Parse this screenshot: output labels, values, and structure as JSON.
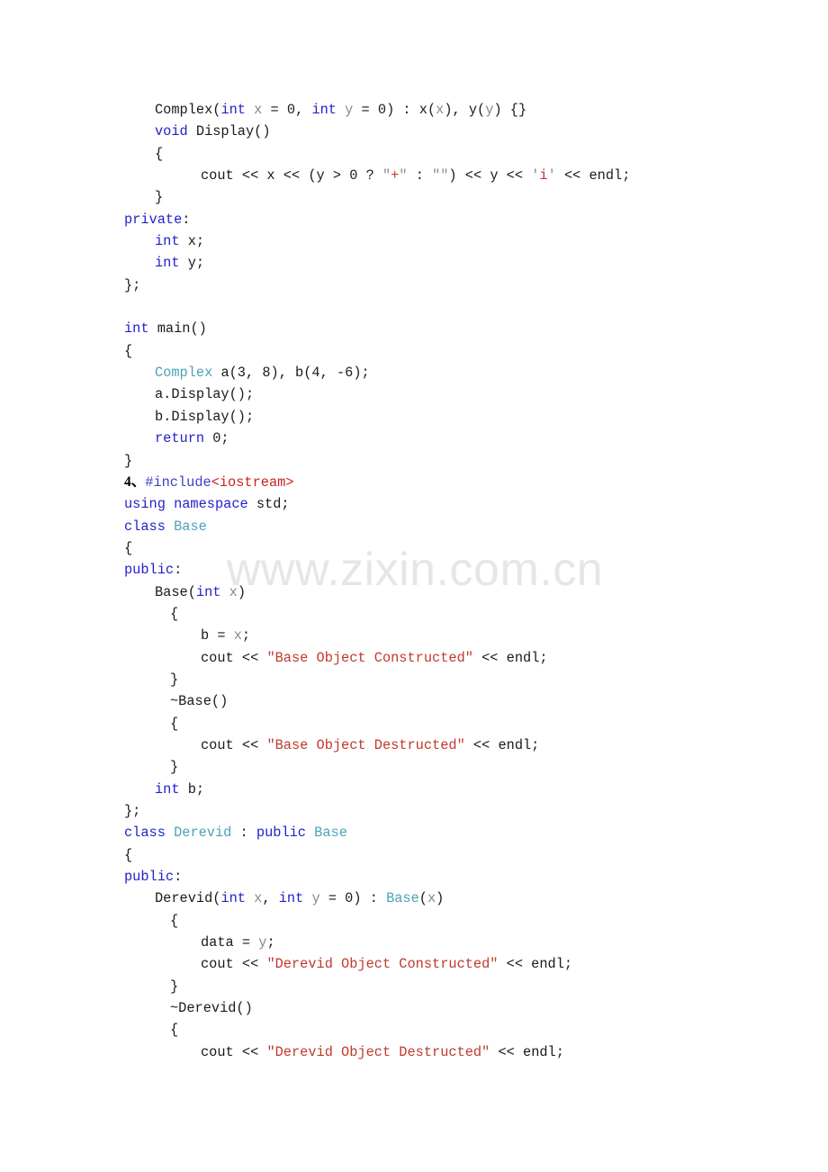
{
  "document": {
    "type": "code-listing",
    "language": "C++",
    "watermark": "www.zixin.com.cn"
  },
  "colors": {
    "keyword": "#2222cc",
    "user_type": "#4ba3b8",
    "string": "#c0392b",
    "preprocessor": "#4040c8",
    "include_header": "#cc2222",
    "parameter": "#888888",
    "plain": "#1a1a1a",
    "watermark": "#e6e6e6",
    "background": "#ffffff"
  },
  "code_lines": [
    {
      "indent": 1,
      "tokens": [
        {
          "t": "Complex(",
          "c": "plain"
        },
        {
          "t": "int",
          "c": "kw"
        },
        {
          "t": " ",
          "c": "plain"
        },
        {
          "t": "x",
          "c": "param"
        },
        {
          "t": " = 0, ",
          "c": "plain"
        },
        {
          "t": "int",
          "c": "kw"
        },
        {
          "t": " ",
          "c": "plain"
        },
        {
          "t": "y",
          "c": "param"
        },
        {
          "t": " = 0) : x(",
          "c": "plain"
        },
        {
          "t": "x",
          "c": "param"
        },
        {
          "t": "), y(",
          "c": "plain"
        },
        {
          "t": "y",
          "c": "param"
        },
        {
          "t": ") {}",
          "c": "plain"
        }
      ]
    },
    {
      "indent": 1,
      "tokens": [
        {
          "t": "void",
          "c": "kw"
        },
        {
          "t": " Display()",
          "c": "plain"
        }
      ]
    },
    {
      "indent": 1,
      "tokens": [
        {
          "t": "{",
          "c": "plain"
        }
      ]
    },
    {
      "indent": 3,
      "tokens": [
        {
          "t": "cout << x << (y > 0 ? ",
          "c": "plain"
        },
        {
          "t": "\"",
          "c": "strq"
        },
        {
          "t": "+",
          "c": "str"
        },
        {
          "t": "\"",
          "c": "strq"
        },
        {
          "t": " : ",
          "c": "plain"
        },
        {
          "t": "\"\"",
          "c": "strq"
        },
        {
          "t": ") << y << ",
          "c": "plain"
        },
        {
          "t": "'",
          "c": "strq"
        },
        {
          "t": "i",
          "c": "str"
        },
        {
          "t": "'",
          "c": "strq"
        },
        {
          "t": " << endl;",
          "c": "plain"
        }
      ]
    },
    {
      "indent": 1,
      "tokens": [
        {
          "t": "}",
          "c": "plain"
        }
      ]
    },
    {
      "indent": 0,
      "tokens": [
        {
          "t": "private",
          "c": "kw"
        },
        {
          "t": ":",
          "c": "plain"
        }
      ]
    },
    {
      "indent": 1,
      "tokens": [
        {
          "t": "int",
          "c": "kw"
        },
        {
          "t": " x;",
          "c": "plain"
        }
      ]
    },
    {
      "indent": 1,
      "tokens": [
        {
          "t": "int",
          "c": "kw"
        },
        {
          "t": " y;",
          "c": "plain"
        }
      ]
    },
    {
      "indent": 0,
      "tokens": [
        {
          "t": "};",
          "c": "plain"
        }
      ]
    },
    {
      "indent": 0,
      "tokens": [
        {
          "t": "",
          "c": "plain"
        }
      ]
    },
    {
      "indent": 0,
      "tokens": [
        {
          "t": "int",
          "c": "kw"
        },
        {
          "t": " main()",
          "c": "plain"
        }
      ]
    },
    {
      "indent": 0,
      "tokens": [
        {
          "t": "{",
          "c": "plain"
        }
      ]
    },
    {
      "indent": 1,
      "tokens": [
        {
          "t": "Complex",
          "c": "type"
        },
        {
          "t": " a(3, 8), b(4, -6);",
          "c": "plain"
        }
      ]
    },
    {
      "indent": 1,
      "tokens": [
        {
          "t": "a.Display();",
          "c": "plain"
        }
      ]
    },
    {
      "indent": 1,
      "tokens": [
        {
          "t": "b.Display();",
          "c": "plain"
        }
      ]
    },
    {
      "indent": 1,
      "tokens": [
        {
          "t": "return",
          "c": "kw"
        },
        {
          "t": " 0;",
          "c": "plain"
        }
      ]
    },
    {
      "indent": 0,
      "tokens": [
        {
          "t": "}",
          "c": "plain"
        }
      ]
    },
    {
      "indent": 0,
      "tokens": [
        {
          "t": "4、",
          "c": "qnum"
        },
        {
          "t": "#include",
          "c": "pre"
        },
        {
          "t": "<iostream>",
          "c": "inc"
        }
      ]
    },
    {
      "indent": 0,
      "tokens": [
        {
          "t": "using namespace",
          "c": "kw"
        },
        {
          "t": " std;",
          "c": "plain"
        }
      ]
    },
    {
      "indent": 0,
      "tokens": [
        {
          "t": "class",
          "c": "kw"
        },
        {
          "t": " ",
          "c": "plain"
        },
        {
          "t": "Base",
          "c": "type"
        }
      ]
    },
    {
      "indent": 0,
      "tokens": [
        {
          "t": "{",
          "c": "plain"
        }
      ]
    },
    {
      "indent": 0,
      "tokens": [
        {
          "t": "public",
          "c": "kw"
        },
        {
          "t": ":",
          "c": "plain"
        }
      ]
    },
    {
      "indent": 1,
      "tokens": [
        {
          "t": "Base(",
          "c": "plain"
        },
        {
          "t": "int",
          "c": "kw"
        },
        {
          "t": " ",
          "c": "plain"
        },
        {
          "t": "x",
          "c": "param"
        },
        {
          "t": ")",
          "c": "plain"
        }
      ]
    },
    {
      "indent": 2,
      "tokens": [
        {
          "t": "{",
          "c": "plain"
        }
      ]
    },
    {
      "indent": 3,
      "tokens": [
        {
          "t": "b = ",
          "c": "plain"
        },
        {
          "t": "x",
          "c": "param"
        },
        {
          "t": ";",
          "c": "plain"
        }
      ]
    },
    {
      "indent": 3,
      "tokens": [
        {
          "t": "cout << ",
          "c": "plain"
        },
        {
          "t": "\"Base Object Constructed\"",
          "c": "str"
        },
        {
          "t": " << endl;",
          "c": "plain"
        }
      ]
    },
    {
      "indent": 2,
      "tokens": [
        {
          "t": "}",
          "c": "plain"
        }
      ]
    },
    {
      "indent": 2,
      "tokens": [
        {
          "t": "~Base()",
          "c": "plain"
        }
      ]
    },
    {
      "indent": 2,
      "tokens": [
        {
          "t": "{",
          "c": "plain"
        }
      ]
    },
    {
      "indent": 3,
      "tokens": [
        {
          "t": "cout << ",
          "c": "plain"
        },
        {
          "t": "\"Base Object Destructed\"",
          "c": "str"
        },
        {
          "t": " << endl;",
          "c": "plain"
        }
      ]
    },
    {
      "indent": 2,
      "tokens": [
        {
          "t": "}",
          "c": "plain"
        }
      ]
    },
    {
      "indent": 1,
      "tokens": [
        {
          "t": "int",
          "c": "kw"
        },
        {
          "t": " b;",
          "c": "plain"
        }
      ]
    },
    {
      "indent": 0,
      "tokens": [
        {
          "t": "};",
          "c": "plain"
        }
      ]
    },
    {
      "indent": 0,
      "tokens": [
        {
          "t": "class",
          "c": "kw"
        },
        {
          "t": " ",
          "c": "plain"
        },
        {
          "t": "Derevid",
          "c": "type"
        },
        {
          "t": " : ",
          "c": "plain"
        },
        {
          "t": "public",
          "c": "kw"
        },
        {
          "t": " ",
          "c": "plain"
        },
        {
          "t": "Base",
          "c": "type"
        }
      ]
    },
    {
      "indent": 0,
      "tokens": [
        {
          "t": "{",
          "c": "plain"
        }
      ]
    },
    {
      "indent": 0,
      "tokens": [
        {
          "t": "public",
          "c": "kw"
        },
        {
          "t": ":",
          "c": "plain"
        }
      ]
    },
    {
      "indent": 1,
      "tokens": [
        {
          "t": "Derevid(",
          "c": "plain"
        },
        {
          "t": "int",
          "c": "kw"
        },
        {
          "t": " ",
          "c": "plain"
        },
        {
          "t": "x",
          "c": "param"
        },
        {
          "t": ", ",
          "c": "plain"
        },
        {
          "t": "int",
          "c": "kw"
        },
        {
          "t": " ",
          "c": "plain"
        },
        {
          "t": "y",
          "c": "param"
        },
        {
          "t": " = 0) : ",
          "c": "plain"
        },
        {
          "t": "Base",
          "c": "type"
        },
        {
          "t": "(",
          "c": "plain"
        },
        {
          "t": "x",
          "c": "param"
        },
        {
          "t": ")",
          "c": "plain"
        }
      ]
    },
    {
      "indent": 2,
      "tokens": [
        {
          "t": "{",
          "c": "plain"
        }
      ]
    },
    {
      "indent": 3,
      "tokens": [
        {
          "t": "data = ",
          "c": "plain"
        },
        {
          "t": "y",
          "c": "param"
        },
        {
          "t": ";",
          "c": "plain"
        }
      ]
    },
    {
      "indent": 3,
      "tokens": [
        {
          "t": "cout << ",
          "c": "plain"
        },
        {
          "t": "\"Derevid Object Constructed\"",
          "c": "str"
        },
        {
          "t": " << endl;",
          "c": "plain"
        }
      ]
    },
    {
      "indent": 2,
      "tokens": [
        {
          "t": "}",
          "c": "plain"
        }
      ]
    },
    {
      "indent": 2,
      "tokens": [
        {
          "t": "~Derevid()",
          "c": "plain"
        }
      ]
    },
    {
      "indent": 2,
      "tokens": [
        {
          "t": "{",
          "c": "plain"
        }
      ]
    },
    {
      "indent": 3,
      "tokens": [
        {
          "t": "cout << ",
          "c": "plain"
        },
        {
          "t": "\"Derevid Object Destructed\"",
          "c": "str"
        },
        {
          "t": " << endl;",
          "c": "plain"
        }
      ]
    }
  ],
  "plain_text": [
    "    Complex(int x = 0, int y = 0) : x(x), y(y) {}",
    "    void Display()",
    "    {",
    "        cout << x << (y > 0 ? \"+\" : \"\") << y << 'i' << endl;",
    "    }",
    "private:",
    "    int x;",
    "    int y;",
    "};",
    "",
    "int main()",
    "{",
    "    Complex a(3, 8), b(4, -6);",
    "    a.Display();",
    "    b.Display();",
    "    return 0;",
    "}",
    "4、#include<iostream>",
    "using namespace std;",
    "class Base",
    "{",
    "public:",
    "    Base(int x)",
    "     {",
    "        b = x;",
    "        cout << \"Base Object Constructed\" << endl;",
    "     }",
    "     ~Base()",
    "     {",
    "        cout << \"Base Object Destructed\" << endl;",
    "     }",
    "    int b;",
    "};",
    "class Derevid : public Base",
    "{",
    "public:",
    "    Derevid(int x, int y = 0) : Base(x)",
    "     {",
    "        data = y;",
    "        cout << \"Derevid Object Constructed\" << endl;",
    "     }",
    "     ~Derevid()",
    "     {",
    "        cout << \"Derevid Object Destructed\" << endl;"
  ]
}
